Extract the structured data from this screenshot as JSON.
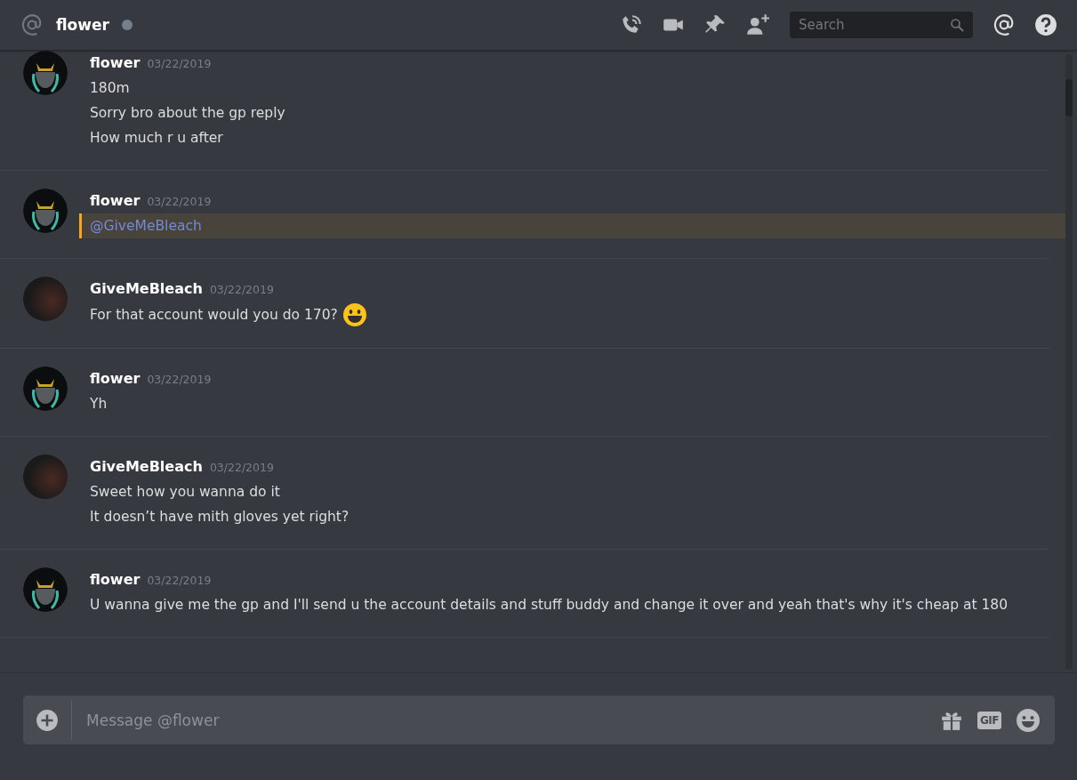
{
  "header": {
    "channel": "flower",
    "online": false,
    "search": {
      "placeholder": "Search"
    }
  },
  "messages": [
    {
      "author": "flower",
      "timestamp": "03/22/2019",
      "avatar": {
        "kind": "artwork"
      },
      "lines": [
        {
          "kind": "text",
          "text": "180m",
          "emoji": false
        },
        {
          "kind": "text",
          "text": "Sorry bro about the gp reply",
          "emoji": false
        },
        {
          "kind": "text",
          "text": "How much r u after",
          "emoji": false
        }
      ]
    },
    {
      "author": "flower",
      "timestamp": "03/22/2019",
      "avatar": {
        "kind": "artwork"
      },
      "lines": [
        {
          "kind": "mention",
          "text": "@GiveMeBleach",
          "emoji": false
        }
      ]
    },
    {
      "author": "GiveMeBleach",
      "timestamp": "03/22/2019",
      "avatar": {
        "kind": "photo"
      },
      "lines": [
        {
          "kind": "text",
          "text": "For that account would you do 170?",
          "emoji": true
        }
      ]
    },
    {
      "author": "flower",
      "timestamp": "03/22/2019",
      "avatar": {
        "kind": "artwork"
      },
      "lines": [
        {
          "kind": "text",
          "text": "Yh",
          "emoji": false
        }
      ]
    },
    {
      "author": "GiveMeBleach",
      "timestamp": "03/22/2019",
      "avatar": {
        "kind": "photo"
      },
      "lines": [
        {
          "kind": "text",
          "text": "Sweet how you wanna do it",
          "emoji": false
        },
        {
          "kind": "text",
          "text": "It doesn’t have mith gloves yet right?",
          "emoji": false
        }
      ]
    },
    {
      "author": "flower",
      "timestamp": "03/22/2019",
      "avatar": {
        "kind": "artwork"
      },
      "lines": [
        {
          "kind": "text",
          "text": "U wanna give me the gp and I'll send u the account details and stuff buddy and change it over and yeah that's why it's cheap at 180",
          "emoji": false
        }
      ]
    }
  ],
  "composer": {
    "placeholder": "Message @flower",
    "gif_label": "GIF"
  }
}
